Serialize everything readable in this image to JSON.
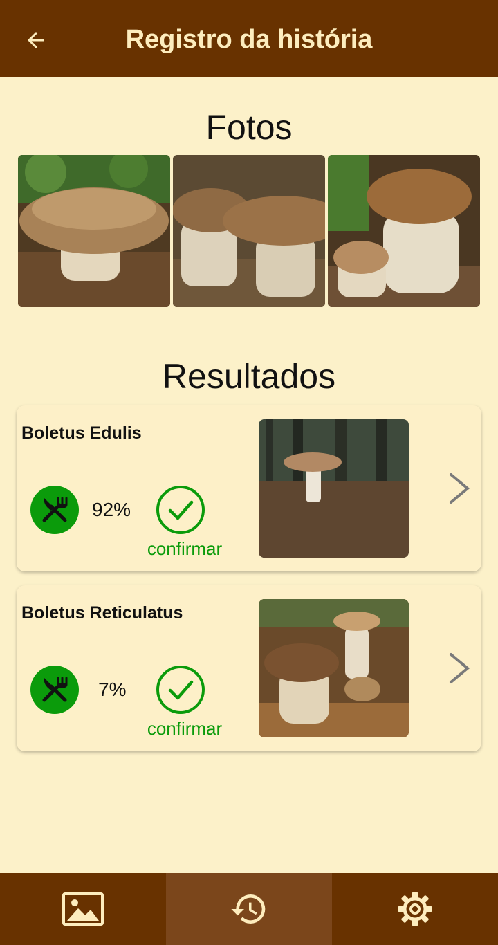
{
  "appbar": {
    "title": "Registro da história",
    "back_icon": "arrow-left-icon"
  },
  "photos": {
    "title": "Fotos",
    "items": [
      {
        "alt": "mushroom photo 1"
      },
      {
        "alt": "mushroom photo 2"
      },
      {
        "alt": "mushroom photo 3"
      }
    ]
  },
  "results": {
    "title": "Resultados",
    "items": [
      {
        "name": "Boletus Edulis",
        "percent": "92%",
        "confirm_label": "confirmar",
        "edible_icon": "fork-knife-icon"
      },
      {
        "name": "Boletus Reticulatus",
        "percent": "7%",
        "confirm_label": "confirmar",
        "edible_icon": "fork-knife-icon"
      }
    ]
  },
  "bottom_nav": {
    "items": [
      {
        "name": "gallery",
        "icon": "image-icon",
        "active": false
      },
      {
        "name": "history",
        "icon": "history-icon",
        "active": true
      },
      {
        "name": "settings",
        "icon": "gear-icon",
        "active": false
      }
    ]
  },
  "colors": {
    "appbar": "#683200",
    "background": "#fcf1c9",
    "accent_green": "#0b9b0b",
    "active_nav": "#7b461b",
    "appbar_text": "#fdedbe"
  }
}
